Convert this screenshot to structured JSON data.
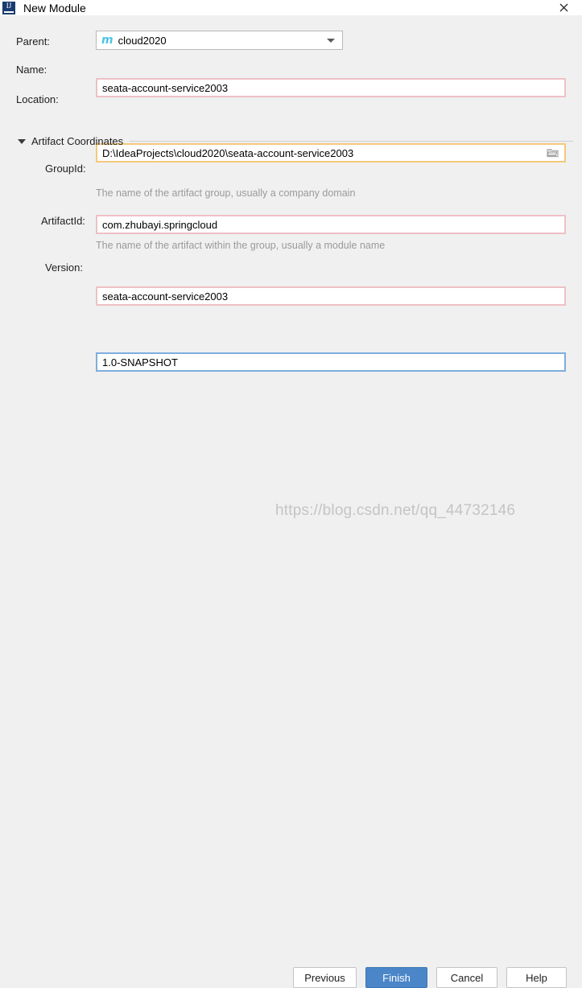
{
  "window": {
    "title": "New Module",
    "app_icon": "intellij-idea-icon",
    "icon_text": "IJ",
    "close_label": "×"
  },
  "form": {
    "parent": {
      "label": "Parent:",
      "value": "cloud2020",
      "icon": "maven-module-icon",
      "icon_glyph": "m",
      "icon_color": "#4ec3e8",
      "dropdown_icon": "chevron-down-icon"
    },
    "name": {
      "label": "Name:",
      "value": "seata-account-service2003",
      "state": "error",
      "border_color": "#eec0c6"
    },
    "location": {
      "label": "Location:",
      "value": "D:\\IdeaProjects\\cloud2020\\seata-account-service2003",
      "state": "warning",
      "border_color": "#f5c87c",
      "browse_icon": "folder-icon"
    }
  },
  "artifact_section": {
    "title": "Artifact Coordinates",
    "expanded": true,
    "collapse_icon": "triangle-down-icon",
    "fields": [
      {
        "label": "GroupId:",
        "value": "com.zhubayi.springcloud",
        "hint": "The name of the artifact group, usually a company domain",
        "state": "error",
        "border_color": "#eec0c6"
      },
      {
        "label": "ArtifactId:",
        "value": "seata-account-service2003",
        "hint": "The name of the artifact within the group, usually a module name",
        "state": "error",
        "border_color": "#eec0c6"
      },
      {
        "label": "Version:",
        "value": "1.0-SNAPSHOT",
        "hint": "",
        "state": "focused",
        "border_color": "#7daede"
      }
    ]
  },
  "buttons": {
    "previous": "Previous",
    "finish": "Finish",
    "cancel": "Cancel",
    "help": "Help",
    "primary_color": "#4a86c8"
  },
  "watermark": {
    "text": "https://blog.csdn.net/qq_44732146"
  }
}
